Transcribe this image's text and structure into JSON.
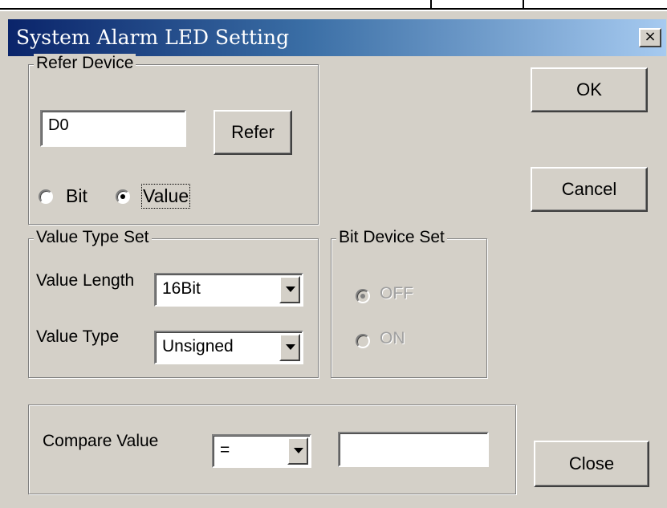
{
  "window": {
    "title": "System Alarm LED Setting",
    "close_glyph": "×"
  },
  "buttons": {
    "ok": "OK",
    "cancel": "Cancel",
    "close": "Close",
    "refer": "Refer"
  },
  "refer_device": {
    "legend": "Refer Device",
    "device_value": "D0",
    "options": {
      "bit": "Bit",
      "value": "Value"
    },
    "selected": "Value"
  },
  "value_type_set": {
    "legend": "Value Type Set",
    "length_label": "Value Length",
    "length_value": "16Bit",
    "type_label": "Value Type",
    "type_value": "Unsigned"
  },
  "bit_device_set": {
    "legend": "Bit Device Set",
    "off_label": "OFF",
    "on_label": "ON",
    "selected": "OFF",
    "enabled": false
  },
  "compare": {
    "label": "Compare Value",
    "operator": "=",
    "value": ""
  },
  "colors": {
    "titlebar_start": "#0a246a",
    "titlebar_end": "#a6caf0",
    "face": "#d4d0c8"
  }
}
